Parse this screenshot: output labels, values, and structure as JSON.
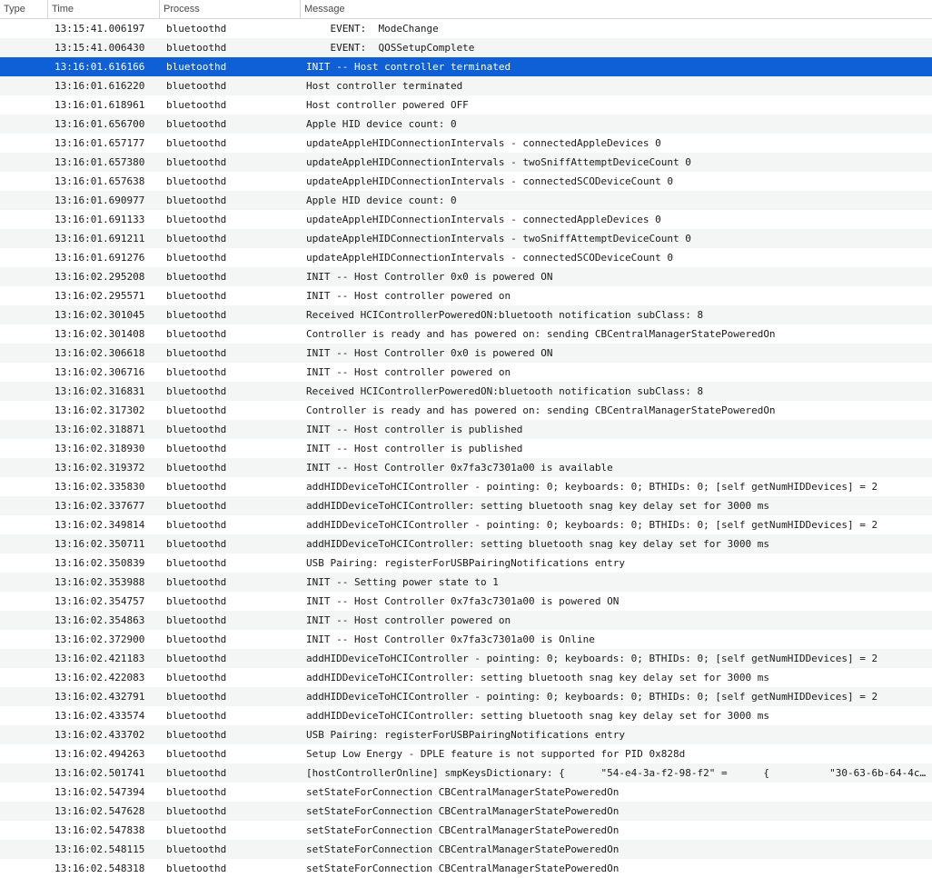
{
  "columns": {
    "type": "Type",
    "time": "Time",
    "process": "Process",
    "message": "Message"
  },
  "colors": {
    "selected_row": "#0f5fd6",
    "alt_row": "#f4f5f5"
  },
  "selected_index": 2,
  "rows": [
    {
      "time": "13:15:41.006197",
      "process": "bluetoothd",
      "message": "    EVENT:  ModeChange"
    },
    {
      "time": "13:15:41.006430",
      "process": "bluetoothd",
      "message": "    EVENT:  QOSSetupComplete"
    },
    {
      "time": "13:16:01.616166",
      "process": "bluetoothd",
      "message": "INIT -- Host controller terminated"
    },
    {
      "time": "13:16:01.616220",
      "process": "bluetoothd",
      "message": "Host controller terminated"
    },
    {
      "time": "13:16:01.618961",
      "process": "bluetoothd",
      "message": "Host controller powered OFF"
    },
    {
      "time": "13:16:01.656700",
      "process": "bluetoothd",
      "message": "Apple HID device count: 0"
    },
    {
      "time": "13:16:01.657177",
      "process": "bluetoothd",
      "message": "updateAppleHIDConnectionIntervals - connectedAppleDevices 0"
    },
    {
      "time": "13:16:01.657380",
      "process": "bluetoothd",
      "message": "updateAppleHIDConnectionIntervals - twoSniffAttemptDeviceCount 0"
    },
    {
      "time": "13:16:01.657638",
      "process": "bluetoothd",
      "message": "updateAppleHIDConnectionIntervals - connectedSCODeviceCount 0"
    },
    {
      "time": "13:16:01.690977",
      "process": "bluetoothd",
      "message": "Apple HID device count: 0"
    },
    {
      "time": "13:16:01.691133",
      "process": "bluetoothd",
      "message": "updateAppleHIDConnectionIntervals - connectedAppleDevices 0"
    },
    {
      "time": "13:16:01.691211",
      "process": "bluetoothd",
      "message": "updateAppleHIDConnectionIntervals - twoSniffAttemptDeviceCount 0"
    },
    {
      "time": "13:16:01.691276",
      "process": "bluetoothd",
      "message": "updateAppleHIDConnectionIntervals - connectedSCODeviceCount 0"
    },
    {
      "time": "13:16:02.295208",
      "process": "bluetoothd",
      "message": "INIT -- Host Controller 0x0 is powered ON"
    },
    {
      "time": "13:16:02.295571",
      "process": "bluetoothd",
      "message": "INIT -- Host controller powered on"
    },
    {
      "time": "13:16:02.301045",
      "process": "bluetoothd",
      "message": "Received HCIControllerPoweredON:bluetooth notification subClass: 8"
    },
    {
      "time": "13:16:02.301408",
      "process": "bluetoothd",
      "message": "Controller is ready and has powered on: sending CBCentralManagerStatePoweredOn"
    },
    {
      "time": "13:16:02.306618",
      "process": "bluetoothd",
      "message": "INIT -- Host Controller 0x0 is powered ON"
    },
    {
      "time": "13:16:02.306716",
      "process": "bluetoothd",
      "message": "INIT -- Host controller powered on"
    },
    {
      "time": "13:16:02.316831",
      "process": "bluetoothd",
      "message": "Received HCIControllerPoweredON:bluetooth notification subClass: 8"
    },
    {
      "time": "13:16:02.317302",
      "process": "bluetoothd",
      "message": "Controller is ready and has powered on: sending CBCentralManagerStatePoweredOn"
    },
    {
      "time": "13:16:02.318871",
      "process": "bluetoothd",
      "message": "INIT -- Host controller is published"
    },
    {
      "time": "13:16:02.318930",
      "process": "bluetoothd",
      "message": "INIT -- Host controller is published"
    },
    {
      "time": "13:16:02.319372",
      "process": "bluetoothd",
      "message": "INIT -- Host Controller 0x7fa3c7301a00 is available"
    },
    {
      "time": "13:16:02.335830",
      "process": "bluetoothd",
      "message": "addHIDDeviceToHCIController - pointing: 0; keyboards: 0; BTHIDs: 0; [self getNumHIDDevices] = 2"
    },
    {
      "time": "13:16:02.337677",
      "process": "bluetoothd",
      "message": "addHIDDeviceToHCIController: setting bluetooth snag key delay set for 3000 ms"
    },
    {
      "time": "13:16:02.349814",
      "process": "bluetoothd",
      "message": "addHIDDeviceToHCIController - pointing: 0; keyboards: 0; BTHIDs: 0; [self getNumHIDDevices] = 2"
    },
    {
      "time": "13:16:02.350711",
      "process": "bluetoothd",
      "message": "addHIDDeviceToHCIController: setting bluetooth snag key delay set for 3000 ms"
    },
    {
      "time": "13:16:02.350839",
      "process": "bluetoothd",
      "message": "USB Pairing: registerForUSBPairingNotifications entry"
    },
    {
      "time": "13:16:02.353988",
      "process": "bluetoothd",
      "message": "INIT -- Setting power state to 1"
    },
    {
      "time": "13:16:02.354757",
      "process": "bluetoothd",
      "message": "INIT -- Host Controller 0x7fa3c7301a00 is powered ON"
    },
    {
      "time": "13:16:02.354863",
      "process": "bluetoothd",
      "message": "INIT -- Host controller powered on"
    },
    {
      "time": "13:16:02.372900",
      "process": "bluetoothd",
      "message": "INIT -- Host Controller 0x7fa3c7301a00 is Online"
    },
    {
      "time": "13:16:02.421183",
      "process": "bluetoothd",
      "message": "addHIDDeviceToHCIController - pointing: 0; keyboards: 0; BTHIDs: 0; [self getNumHIDDevices] = 2"
    },
    {
      "time": "13:16:02.422083",
      "process": "bluetoothd",
      "message": "addHIDDeviceToHCIController: setting bluetooth snag key delay set for 3000 ms"
    },
    {
      "time": "13:16:02.432791",
      "process": "bluetoothd",
      "message": "addHIDDeviceToHCIController - pointing: 0; keyboards: 0; BTHIDs: 0; [self getNumHIDDevices] = 2"
    },
    {
      "time": "13:16:02.433574",
      "process": "bluetoothd",
      "message": "addHIDDeviceToHCIController: setting bluetooth snag key delay set for 3000 ms"
    },
    {
      "time": "13:16:02.433702",
      "process": "bluetoothd",
      "message": "USB Pairing: registerForUSBPairingNotifications entry"
    },
    {
      "time": "13:16:02.494263",
      "process": "bluetoothd",
      "message": "Setup Low Energy - DPLE feature is not supported for PID 0x828d"
    },
    {
      "time": "13:16:02.501741",
      "process": "bluetoothd",
      "message": "[hostControllerOnline] smpKeysDictionary: {      \"54-e4-3a-f2-98-f2\" =      {          \"30-63-6b-64-4c…"
    },
    {
      "time": "13:16:02.547394",
      "process": "bluetoothd",
      "message": "setStateForConnection CBCentralManagerStatePoweredOn"
    },
    {
      "time": "13:16:02.547628",
      "process": "bluetoothd",
      "message": "setStateForConnection CBCentralManagerStatePoweredOn"
    },
    {
      "time": "13:16:02.547838",
      "process": "bluetoothd",
      "message": "setStateForConnection CBCentralManagerStatePoweredOn"
    },
    {
      "time": "13:16:02.548115",
      "process": "bluetoothd",
      "message": "setStateForConnection CBCentralManagerStatePoweredOn"
    },
    {
      "time": "13:16:02.548318",
      "process": "bluetoothd",
      "message": "setStateForConnection CBCentralManagerStatePoweredOn"
    }
  ]
}
